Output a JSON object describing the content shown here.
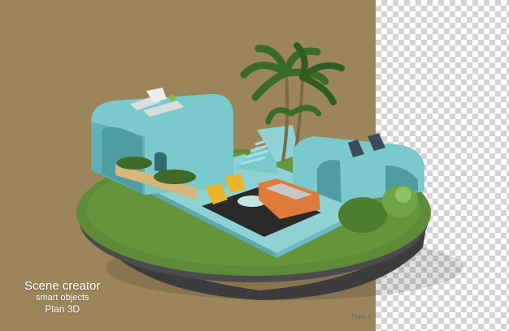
{
  "caption": {
    "line1": "Scene creator",
    "line2": "smart objects",
    "line3": "Plan 3D"
  },
  "plan_tag": "Plan 1",
  "colors": {
    "background": "#9c855a",
    "structure": "#79c9cd",
    "grass": "#5f8a37",
    "rug": "#2a2a2a",
    "sofa": "#e07a3a",
    "armchair": "#e9b52a"
  }
}
